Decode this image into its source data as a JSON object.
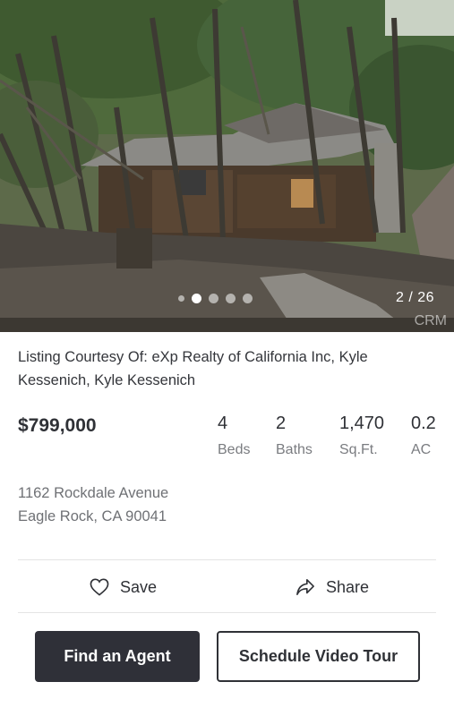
{
  "photo": {
    "counter": "2 / 26",
    "watermark": "CRM",
    "dots_count": 5,
    "active_dot": 1
  },
  "listing": {
    "courtesy": "Listing Courtesy Of: eXp Realty of California Inc, Kyle Kessenich, Kyle Kessenich",
    "price": "$799,000",
    "stats": [
      {
        "value": "4",
        "label": "Beds"
      },
      {
        "value": "2",
        "label": "Baths"
      },
      {
        "value": "1,470",
        "label": "Sq.Ft."
      },
      {
        "value": "0.2",
        "label": "AC"
      }
    ],
    "address_line1": "1162 Rockdale Avenue",
    "address_line2": "Eagle Rock, CA 90041"
  },
  "actions": {
    "save_label": "Save",
    "share_label": "Share"
  },
  "buttons": {
    "find_agent": "Find an Agent",
    "schedule_tour": "Schedule Video Tour"
  },
  "colors": {
    "primary_button": "#2f3038",
    "text": "#2f3136",
    "muted_text": "#7a7c80"
  }
}
